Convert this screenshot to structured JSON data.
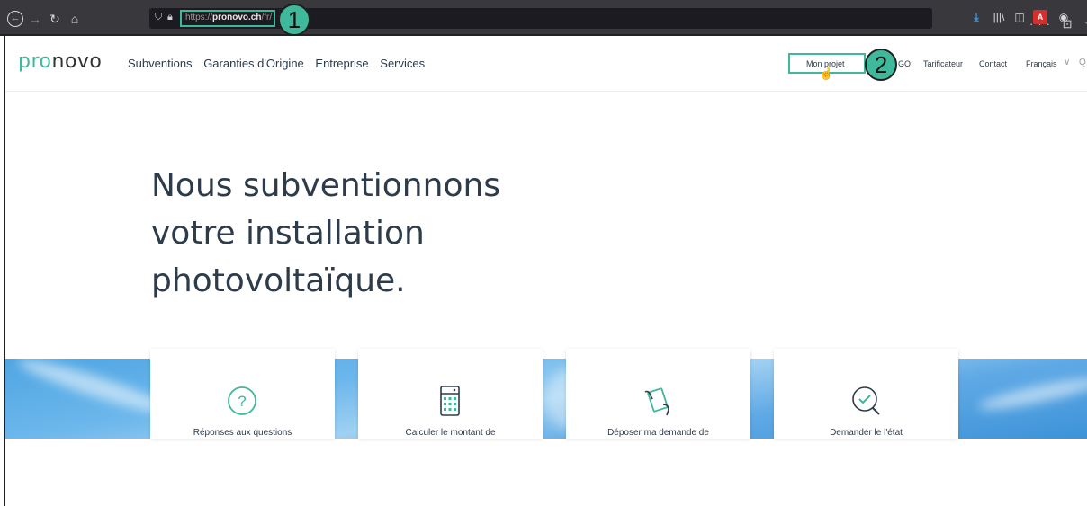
{
  "browser": {
    "url_prefix": "https://",
    "url_domain": "pronovo.ch",
    "url_path": "/fr/",
    "url_actions": "··· ⊡ ☆",
    "toolbar_icons": [
      "download-icon",
      "library-icon",
      "sidebar-icon",
      "pdf-icon",
      "account-icon"
    ]
  },
  "callouts": {
    "one": "1",
    "two": "2"
  },
  "header": {
    "logo_accent": "pro",
    "logo_rest": "novo",
    "nav_items": [
      "Subventions",
      "Garanties d'Origine",
      "Entreprise",
      "Services"
    ],
    "mon_projet": "Mon projet",
    "go": "GO",
    "tarificateur": "Tarificateur",
    "contact": "Contact",
    "language": "Français"
  },
  "hero": {
    "line1": "Nous subventionnons",
    "line2": "votre installation",
    "line3": "photovoltaïque."
  },
  "cards": [
    {
      "label": "Réponses aux questions",
      "icon": "question-icon"
    },
    {
      "label": "Calculer le montant de",
      "icon": "calculator-icon"
    },
    {
      "label": "Déposer ma demande de",
      "icon": "document-hand-icon"
    },
    {
      "label": "Demander le l'état",
      "icon": "check-search-icon"
    }
  ],
  "colors": {
    "accent": "#3fb99b",
    "chrome": "#38383d",
    "text": "#2e3b4a"
  }
}
